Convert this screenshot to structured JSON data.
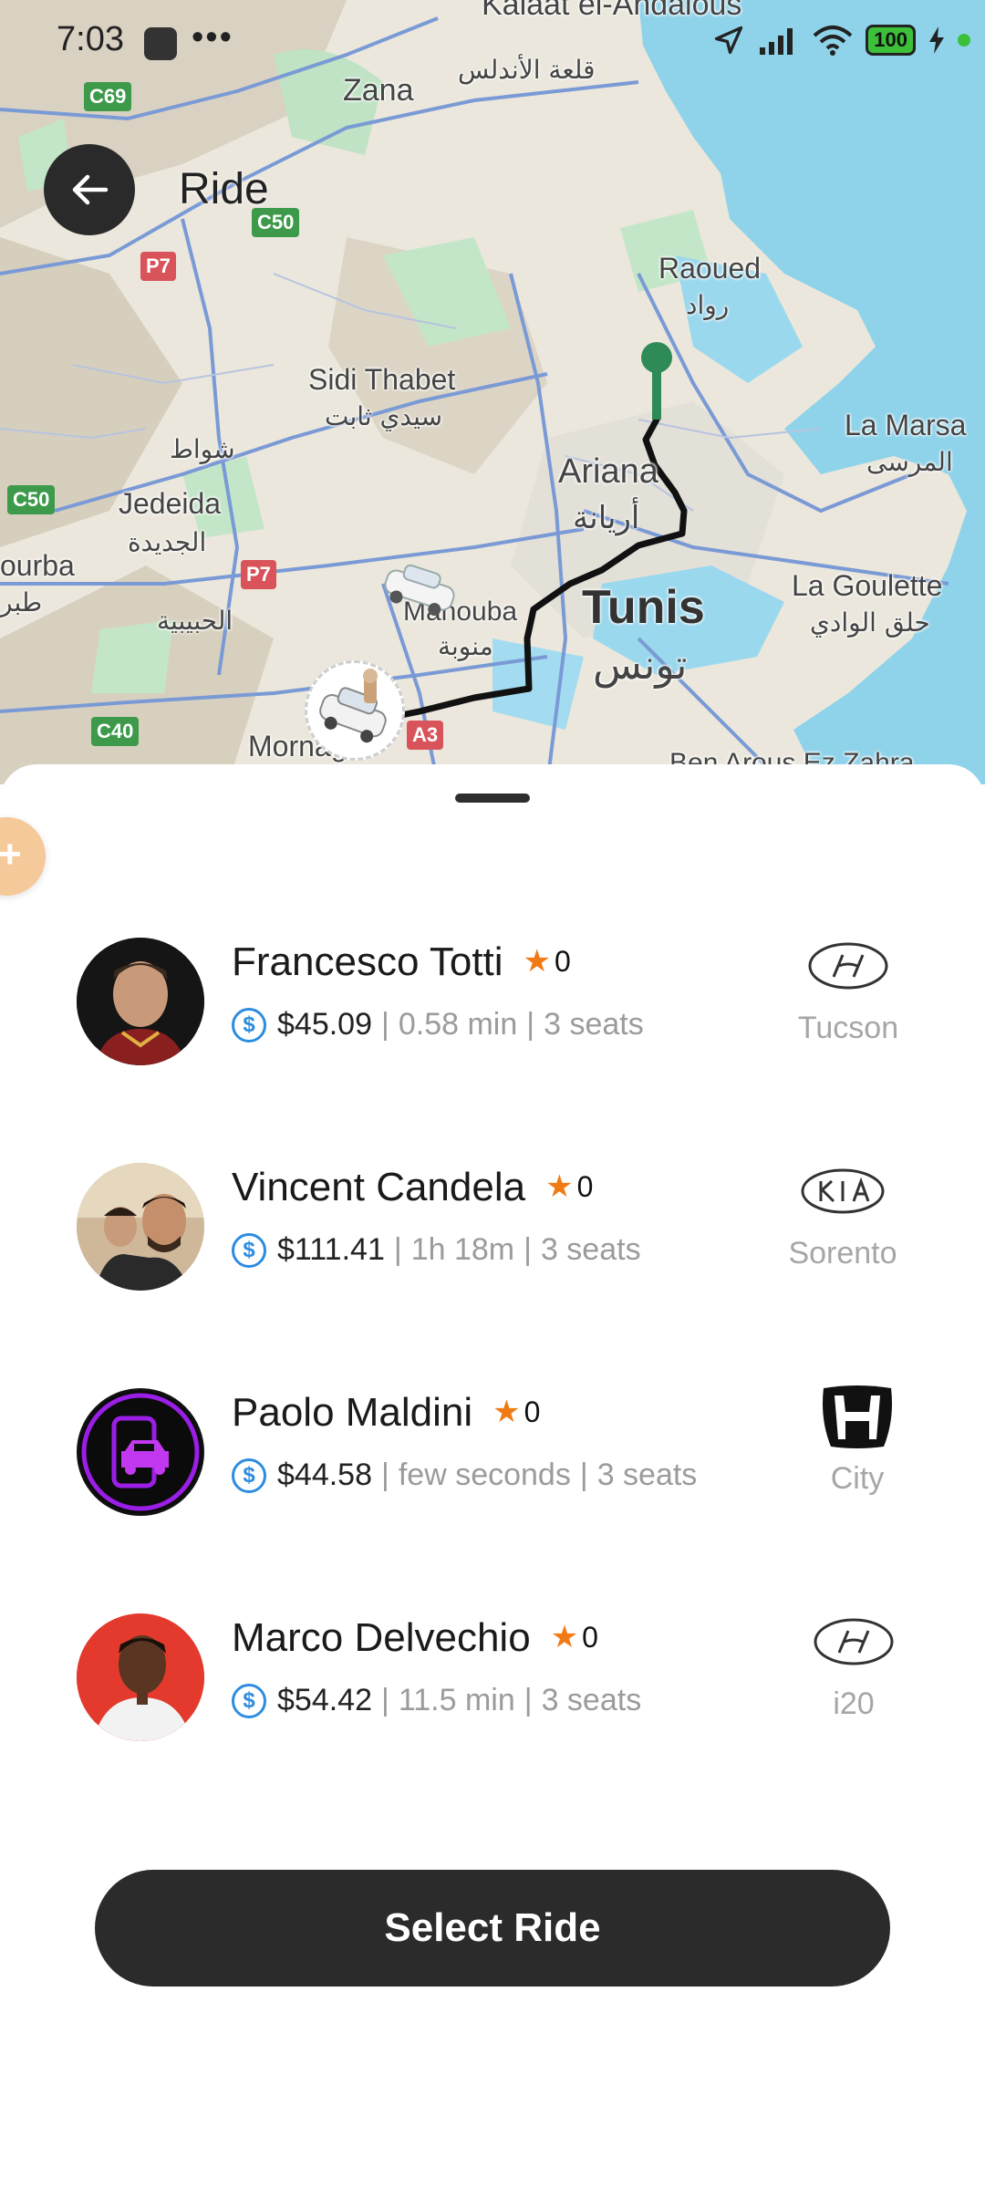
{
  "status": {
    "time": "7:03",
    "dots": "•••",
    "battery": "100"
  },
  "header": {
    "title": "Ride"
  },
  "map": {
    "places": {
      "kalaat": "Kalaat el-Andalous",
      "kalaat_ar": "قلعة الأندلس",
      "zana": "Zana",
      "raoued": "Raoued",
      "raoued_ar": "رواد",
      "sidi_thabet": "Sidi Thabet",
      "sidi_thabet_ar": "سيدي ثابت",
      "chaouat_ar": "شواط",
      "ariana": "Ariana",
      "ariana_ar": "أريانة",
      "la_marsa": "La Marsa",
      "la_marsa_ar": "المرسى",
      "jedeida": "Jedeida",
      "jedeida_ar": "الجديدة",
      "tunis": "Tunis",
      "tunis_ar": "تونس",
      "la_goulette": "La Goulette",
      "la_goulette_ar": "حلق الوادي",
      "tebourba": "ourba",
      "tebourba_ar": "طبر",
      "habibia_ar": "الحبيبية",
      "manouba": "Manouba",
      "manouba_ar": "منوبة",
      "mornag": "Mornag",
      "ben_arous": "Ben Arous  Ez Zahra"
    },
    "road_shields": [
      "C69",
      "C50",
      "P7",
      "C50",
      "P7",
      "C40",
      "A3"
    ]
  },
  "drivers": [
    {
      "name": "Francesco Totti",
      "rating": "0",
      "price": "$45.09",
      "eta": "0.58 min",
      "seats": "3 seats",
      "car_model": "Tucson",
      "car_brand": "hyundai-logo-icon"
    },
    {
      "name": "Vincent Candela",
      "rating": "0",
      "price": "$111.41",
      "eta": "1h 18m",
      "seats": "3 seats",
      "car_model": "Sorento",
      "car_brand": "kia-logo-icon"
    },
    {
      "name": "Paolo Maldini",
      "rating": "0",
      "price": "$44.58",
      "eta": "few seconds",
      "seats": "3 seats",
      "car_model": "City",
      "car_brand": "honda-logo-icon"
    },
    {
      "name": "Marco Delvechio",
      "rating": "0",
      "price": "$54.42",
      "eta": "11.5 min",
      "seats": "3 seats",
      "car_model": "i20",
      "car_brand": "hyundai-logo-icon"
    }
  ],
  "actions": {
    "select_ride": "Select Ride"
  },
  "colors": {
    "accent_dark": "#2b2b2b",
    "star": "#f07b16",
    "dollar": "#2d8ce0",
    "route_start": "#2e8b57",
    "water": "#8fd3ea"
  }
}
